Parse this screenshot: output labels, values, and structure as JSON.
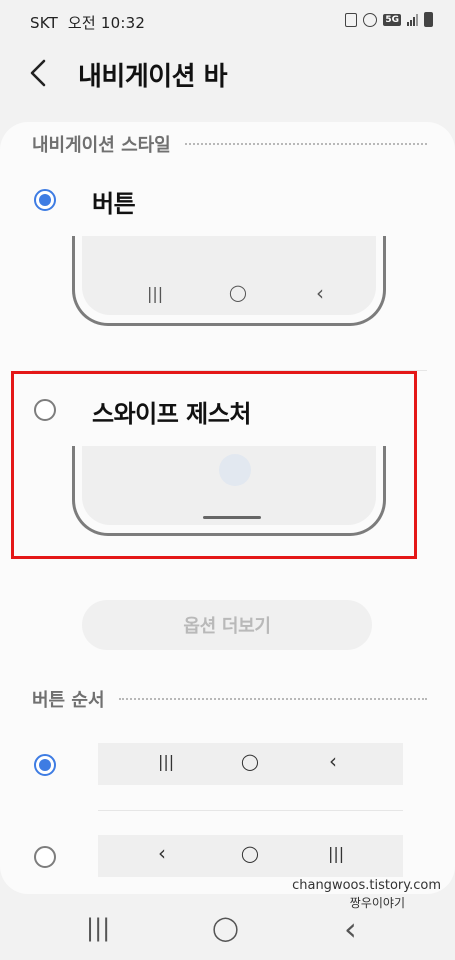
{
  "status_bar": {
    "carrier": "SKT",
    "time": "오전 10:32",
    "network": "5G",
    "icons": [
      "photo-icon",
      "alarm-icon",
      "network-5g-icon",
      "signal-icon",
      "battery-icon"
    ]
  },
  "header": {
    "back_icon": "chevron-left-icon",
    "title": "내비게이션 바"
  },
  "navigation_style": {
    "label": "내비게이션 스타일",
    "options": [
      {
        "label": "버튼",
        "selected": true,
        "preview": [
          "recent-apps-icon",
          "home-icon",
          "back-icon"
        ]
      },
      {
        "label": "스와이프 제스처",
        "selected": false,
        "preview": [
          "gesture-bar"
        ],
        "highlighted": true
      }
    ]
  },
  "more_options_button": "옵션 더보기",
  "button_order": {
    "label": "버튼 순서",
    "options": [
      {
        "selected": true,
        "icons": [
          "recent-apps-icon",
          "home-icon",
          "back-icon"
        ]
      },
      {
        "selected": false,
        "icons": [
          "back-icon",
          "home-icon",
          "recent-apps-icon"
        ]
      }
    ]
  },
  "glyphs": {
    "recent": "|||",
    "home": "◯",
    "back": "‹"
  },
  "watermark": {
    "site": "changwoos.tistory.com",
    "name": "짱우이야기"
  },
  "system_nav": [
    "recent-apps-icon",
    "home-icon",
    "back-icon"
  ],
  "colors": {
    "accent": "#3e7ce3",
    "highlight_box": "#e41818",
    "background": "#f2f2f2",
    "card": "#fbfbfb"
  }
}
